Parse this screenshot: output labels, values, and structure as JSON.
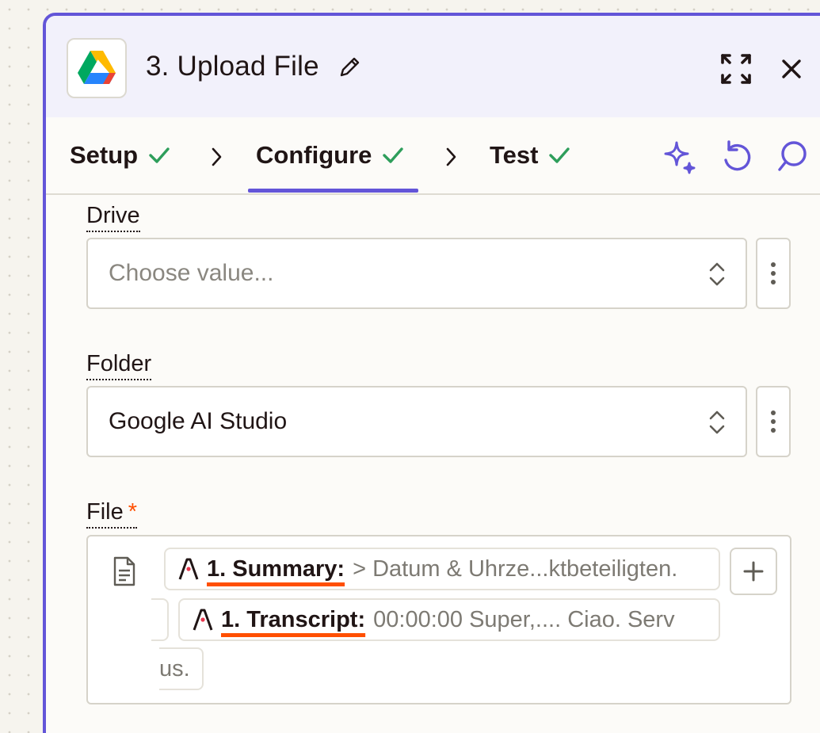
{
  "header": {
    "title": "3. Upload File",
    "app_icon": "google-drive-icon"
  },
  "tabs": [
    {
      "label": "Setup",
      "status": "complete"
    },
    {
      "label": "Configure",
      "status": "complete",
      "active": true
    },
    {
      "label": "Test",
      "status": "complete"
    }
  ],
  "toolbar": {
    "icons": [
      "sparkle-icon",
      "undo-icon",
      "comment-search-icon"
    ]
  },
  "fields": {
    "drive": {
      "label": "Drive",
      "placeholder": "Choose value...",
      "value": ""
    },
    "folder": {
      "label": "Folder",
      "value": "Google AI Studio"
    },
    "file": {
      "label": "File",
      "required_mark": "*",
      "pills": [
        {
          "name": "1. Summary:",
          "value": "> Datum & Uhrze...ktbeteiligten."
        },
        {
          "name": "1. Transcript:",
          "value": "00:00:00 Super,.... Ciao. Serv"
        }
      ],
      "overflow_text": "us."
    }
  },
  "colors": {
    "accent": "#6355d8",
    "check": "#2e9e5b",
    "required": "#ff4f00",
    "pill_underline": "#ff4f00"
  }
}
